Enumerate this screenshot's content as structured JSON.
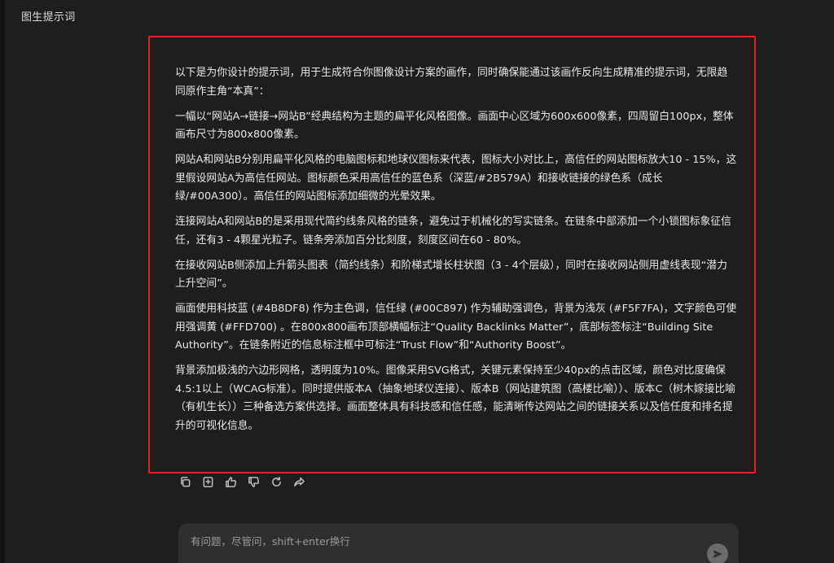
{
  "header": {
    "title": "图生提示词"
  },
  "answer": {
    "paragraphs": [
      "以下是为你设计的提示词，用于生成符合你图像设计方案的画作，同时确保能通过该画作反向生成精准的提示词，无限趋同原作主角“本真”：",
      "一幅以“网站A→链接→网站B”经典结构为主题的扁平化风格图像。画面中心区域为600x600像素，四周留白100px，整体画布尺寸为800x800像素。",
      "网站A和网站B分别用扁平化风格的电脑图标和地球仪图标来代表，图标大小对比上，高信任的网站图标放大10 - 15%，这里假设网站A为高信任网站。图标颜色采用高信任的蓝色系（深蓝/#2B579A）和接收链接的绿色系（成长绿/#00A300）。高信任的网站图标添加细微的光晕效果。",
      "连接网站A和网站B的是采用现代简约线条风格的链条，避免过于机械化的写实链条。在链条中部添加一个小锁图标象征信任，还有3 - 4颗星光粒子。链条旁添加百分比刻度，刻度区间在60 - 80%。",
      "在接收网站B侧添加上升箭头图表（简约线条）和阶梯式增长柱状图（3 - 4个层级），同时在接收网站侧用虚线表现“潜力上升空间”。",
      "画面使用科技蓝 (#4B8DF8) 作为主色调，信任绿 (#00C897) 作为辅助强调色，背景为浅灰 (#F5F7FA)，文字颜色可使用强调黄 (#FFD700) 。在800x800画布顶部横幅标注“Quality Backlinks Matter”，底部标签标注“Building Site Authority”。在链条附近的信息标注框中可标注“Trust Flow”和“Authority Boost”。",
      "背景添加极浅的六边形网格，透明度为10%。图像采用SVG格式，关键元素保持至少40px的点击区域，颜色对比度确保4.5:1以上（WCAG标准）。同时提供版本A（抽象地球仪连接）、版本B（网站建筑图（高楼比喻））、版本C（树木嫁接比喻（有机生长））三种备选方案供选择。画面整体具有科技感和信任感，能清晰传达网站之间的链接关系以及信任度和排名提升的可视化信息。"
    ]
  },
  "toolbar": {
    "icons": [
      "copy-icon",
      "bookmark-icon",
      "thumbs-up-icon",
      "thumbs-down-icon",
      "regenerate-icon",
      "share-icon"
    ]
  },
  "input": {
    "placeholder": "有问题，尽管问，shift+enter换行"
  },
  "colors": {
    "background": "#1e1e1e",
    "highlight_border": "#e02424",
    "input_bg": "#2f2f2f"
  }
}
